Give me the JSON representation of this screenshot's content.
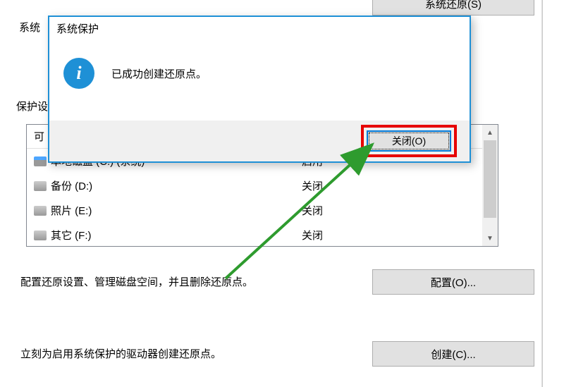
{
  "underlying": {
    "desc_line": "系统",
    "restore_btn": "系统还原(S)",
    "settings_label": "保护设",
    "columns": {
      "col1": "可",
      "col2": ""
    },
    "drives": [
      {
        "name": "本地磁盘 (C:) (系统)",
        "status": "启用",
        "icon": "os"
      },
      {
        "name": "备份 (D:)",
        "status": "关闭",
        "icon": "gray"
      },
      {
        "name": "照片 (E:)",
        "status": "关闭",
        "icon": "gray"
      },
      {
        "name": "其它 (F:)",
        "status": "关闭",
        "icon": "gray"
      }
    ],
    "config_text": "配置还原设置、管理磁盘空间，并且删除还原点。",
    "config_btn": "配置(O)...",
    "create_text": "立刻为启用系统保护的驱动器创建还原点。",
    "create_btn": "创建(C)..."
  },
  "dialog": {
    "title": "系统保护",
    "message": "已成功创建还原点。",
    "close_btn": "关闭(O)",
    "info_glyph": "i"
  }
}
